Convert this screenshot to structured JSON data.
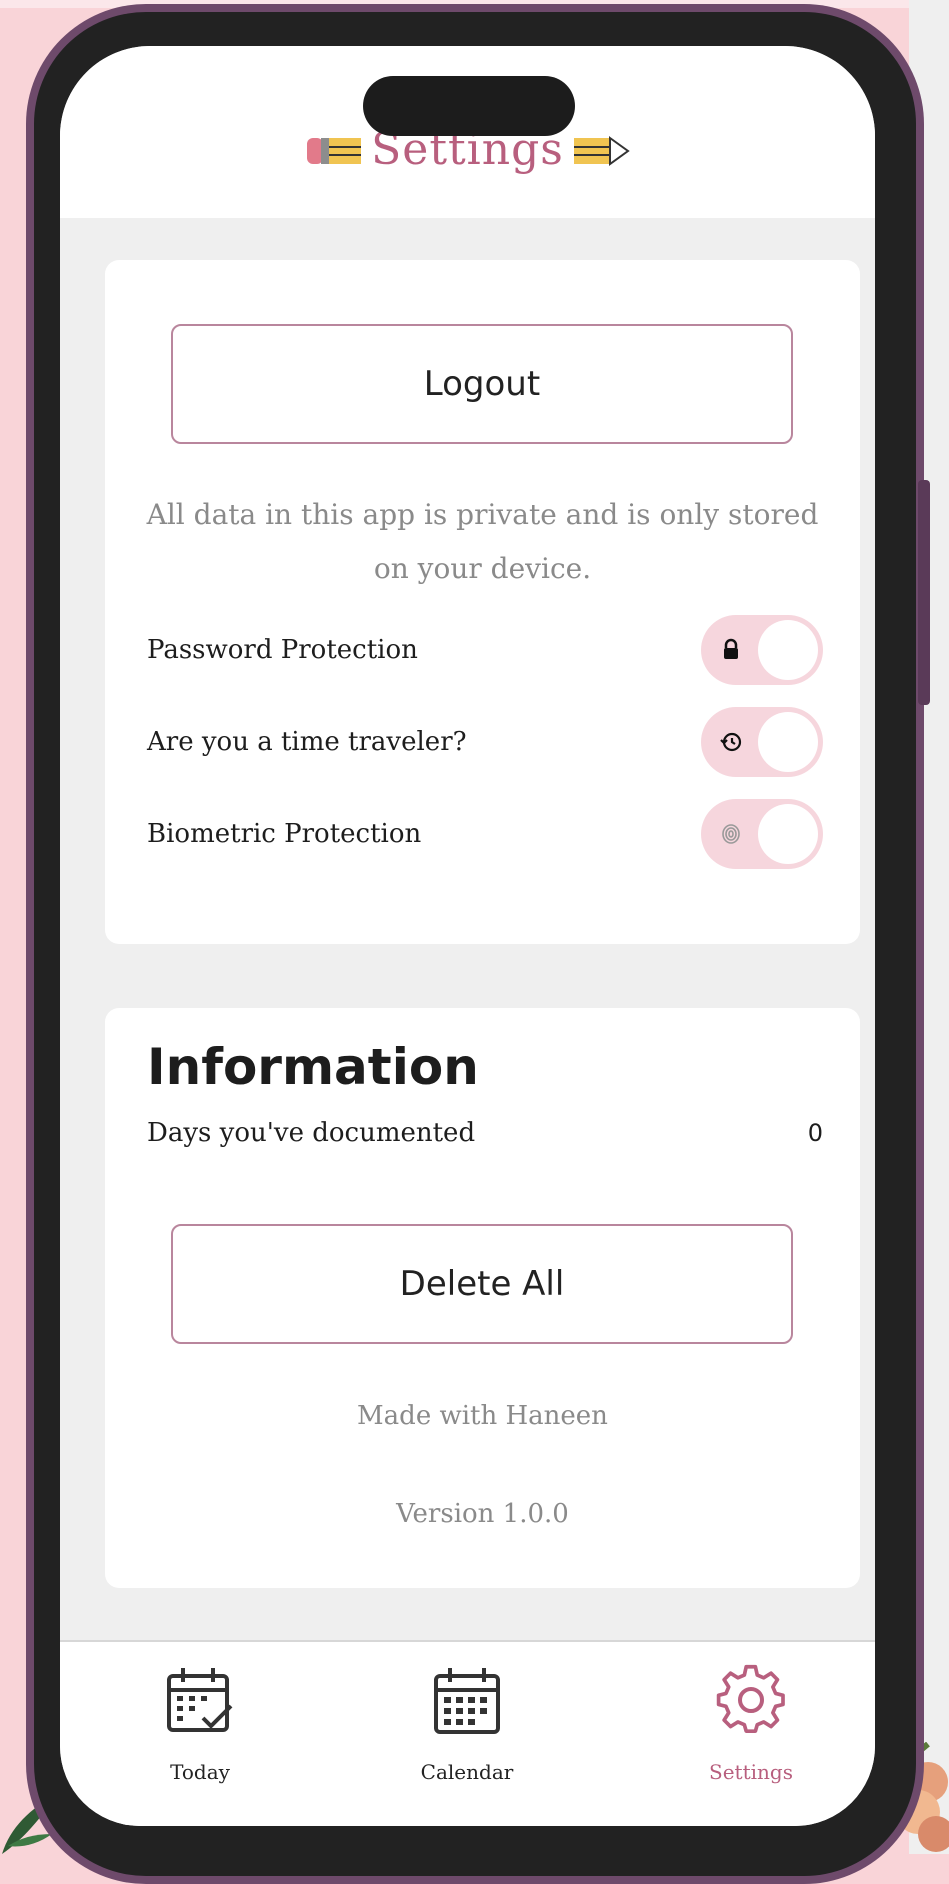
{
  "app": {
    "title": "Settings"
  },
  "account": {
    "logout_label": "Logout",
    "privacy_note": "All data in this app is private and is only stored on your device."
  },
  "toggles": [
    {
      "label": "Password Protection",
      "icon": "lock-icon",
      "on": false
    },
    {
      "label": "Are you a time traveler?",
      "icon": "history-icon",
      "on": false
    },
    {
      "label": "Biometric Protection",
      "icon": "fingerprint-icon",
      "on": false
    }
  ],
  "information": {
    "heading": "Information",
    "days_label": "Days you've documented",
    "days_value": "0",
    "delete_label": "Delete All",
    "made_with": "Made with Haneen",
    "version": "Version 1.0.0"
  },
  "nav": {
    "items": [
      {
        "label": "Today",
        "icon": "calendar-check-icon",
        "active": false
      },
      {
        "label": "Calendar",
        "icon": "calendar-icon",
        "active": false
      },
      {
        "label": "Settings",
        "icon": "gear-icon",
        "active": true
      }
    ]
  },
  "colors": {
    "accent": "#b85f7e",
    "toggle_track": "#f6d6dd",
    "button_border": "#b9869d",
    "background": "#f9d4d8"
  }
}
